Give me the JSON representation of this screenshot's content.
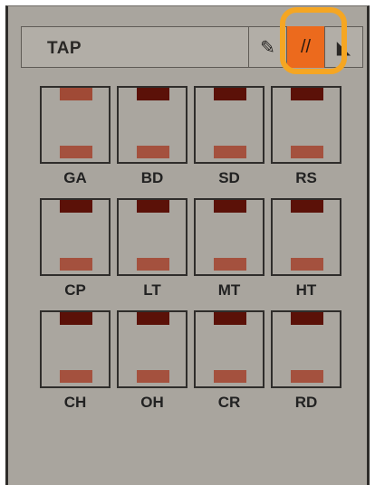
{
  "panel": {
    "title": "TAP"
  },
  "tabs": [
    {
      "icon": "pencil-icon",
      "glyph": "✎"
    },
    {
      "icon": "double-slash-icon",
      "glyph": "//",
      "active": true
    },
    {
      "icon": "eraser-icon",
      "glyph": "◣"
    }
  ],
  "pads": [
    {
      "label": "GA",
      "top_lit": true
    },
    {
      "label": "BD",
      "top_lit": false
    },
    {
      "label": "SD",
      "top_lit": false
    },
    {
      "label": "RS",
      "top_lit": false
    },
    {
      "label": "CP",
      "top_lit": false
    },
    {
      "label": "LT",
      "top_lit": false
    },
    {
      "label": "MT",
      "top_lit": false
    },
    {
      "label": "HT",
      "top_lit": false
    },
    {
      "label": "CH",
      "top_lit": false
    },
    {
      "label": "OH",
      "top_lit": false
    },
    {
      "label": "CR",
      "top_lit": false
    },
    {
      "label": "RD",
      "top_lit": false
    }
  ],
  "colors": {
    "panel_bg": "#a9a59e",
    "active_tab": "#ec6a1d",
    "highlight_ring": "#f5a623",
    "led_dark": "#5b1108",
    "led_light": "#a4513e"
  }
}
